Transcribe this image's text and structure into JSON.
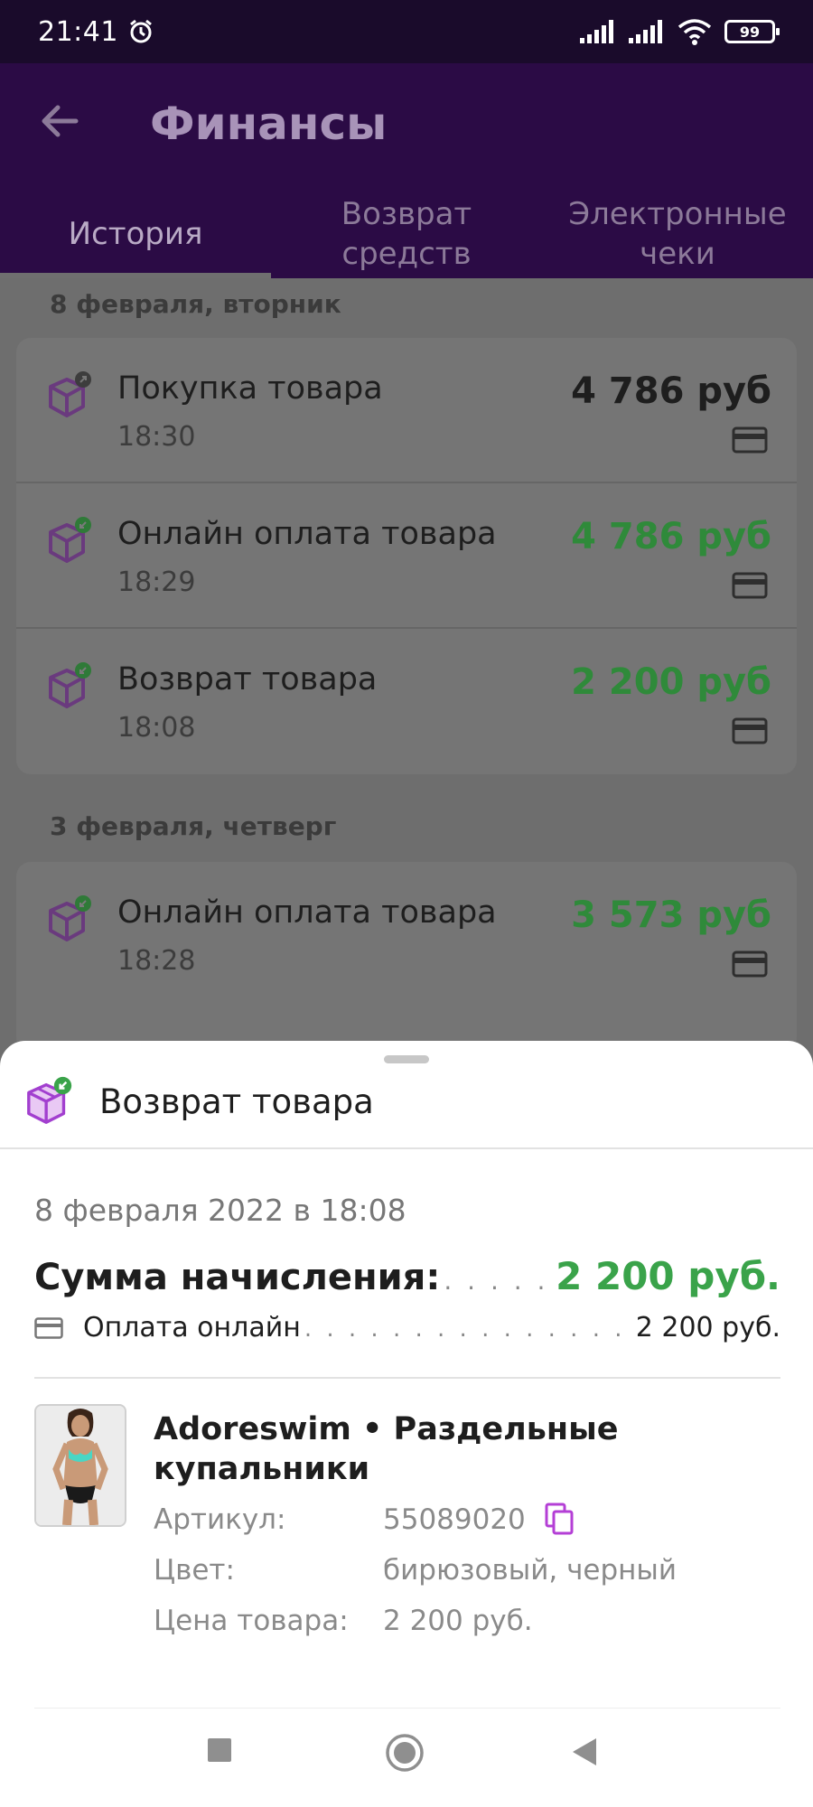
{
  "status_bar": {
    "time": "21:41",
    "battery": "99"
  },
  "header": {
    "title": "Финансы"
  },
  "tabs": [
    {
      "label": "История"
    },
    {
      "label": "Возврат\nсредств"
    },
    {
      "label": "Электронные\nчеки"
    }
  ],
  "groups": [
    {
      "date": "8 февраля, вторник",
      "transactions": [
        {
          "title": "Покупка товара",
          "time": "18:30",
          "amount": "4 786 руб",
          "amount_color": "#1e1e1e",
          "icon": "box-outgoing-icon"
        },
        {
          "title": "Онлайн оплата товара",
          "time": "18:29",
          "amount": "4 786 руб",
          "amount_color": "#2f8a3a",
          "icon": "box-incoming-icon"
        },
        {
          "title": "Возврат товара",
          "time": "18:08",
          "amount": "2 200 руб",
          "amount_color": "#2f8a3a",
          "icon": "box-incoming-icon"
        }
      ]
    },
    {
      "date": "3 февраля, четверг",
      "transactions": [
        {
          "title": "Онлайн оплата товара",
          "time": "18:28",
          "amount": "3 573 руб",
          "amount_color": "#2f8a3a",
          "icon": "box-incoming-icon"
        }
      ]
    }
  ],
  "sheet": {
    "title": "Возврат товара",
    "date": "8 февраля 2022 в 18:08",
    "sum_label": "Сумма начисления:",
    "sum_value": "2 200 руб.",
    "payment_label": "Оплата онлайн",
    "payment_value": "2 200 руб.",
    "product": {
      "name": "Adoreswim • Раздельные купальники",
      "article_label": "Артикул:",
      "article_value": "55089020",
      "color_label": "Цвет:",
      "color_value": "бирюзовый, черный",
      "price_label": "Цена товара:",
      "price_value": "2 200 руб."
    }
  },
  "colors": {
    "accent_purple": "#9c3fc4",
    "positive_green": "#3aa34a",
    "header_bg": "#2b0b45"
  }
}
